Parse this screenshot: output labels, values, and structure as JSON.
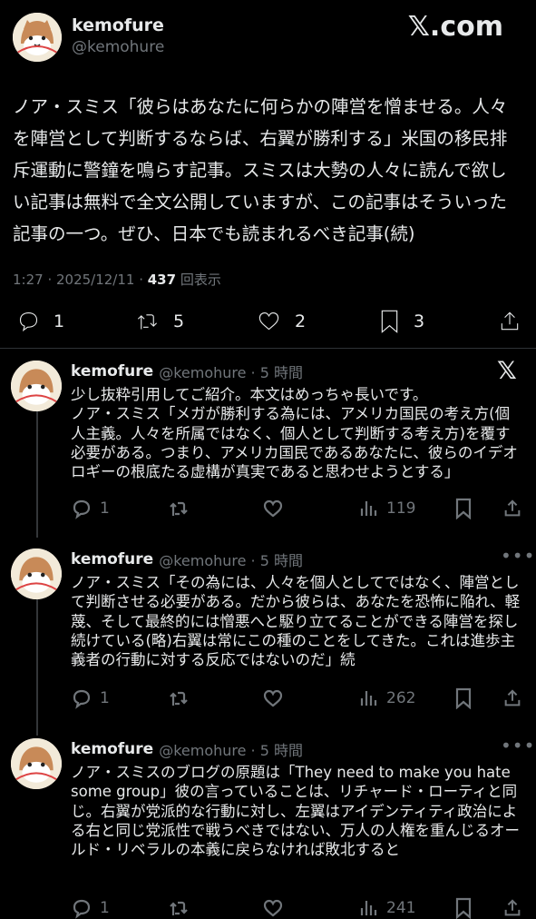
{
  "header": {
    "display_name": "kemofure",
    "handle": "@kemohure",
    "brand": "𝕏.com"
  },
  "main_post": {
    "text": "ノア・スミス「彼らはあなたに何らかの陣営を憎ませる。人々を陣営として判断するならば、右翼が勝利する」米国の移民排斥運動に警鐘を鳴らす記事。スミスは大勢の人々に読んで欲しい記事は無料で全文公開していますが、この記事はそういった記事の一つ。ぜひ、日本でも読まれるべき記事(続)",
    "time": "1:27 · 2025/12/11 · ",
    "views": "437",
    "views_label": " 回表示",
    "actions": {
      "reply": "1",
      "repost": "5",
      "like": "2",
      "bookmark": "3"
    }
  },
  "replies": [
    {
      "name": "kemofure",
      "handle_time": "@kemohure · 5 時間",
      "text": "少し抜粋引用してご紹介。本文はめっちゃ長いです。\nノア・スミス「メガが勝利する為には、アメリカ国民の考え方(個人主義。人々を所属ではなく、個人として判断する考え方)を覆す必要がある。つまり、アメリカ国民であるあなたに、彼らのイデオロギーの根底たる虚構が真実であると思わせようとする」",
      "reply": "1",
      "repost": "",
      "like": "",
      "views": "119"
    },
    {
      "name": "kemofure",
      "handle_time": "@kemohure · 5 時間",
      "text": "ノア・スミス「その為には、人々を個人としてではなく、陣営として判断させる必要がある。だから彼らは、あなたを恐怖に陥れ、軽蔑、そして最終的には憎悪へと駆り立てることができる陣営を探し続けている(略)右翼は常にこの種のことをしてきた。これは進歩主義者の行動に対する反応ではないのだ」続",
      "reply": "1",
      "repost": "",
      "like": "",
      "views": "262"
    },
    {
      "name": "kemofure",
      "handle_time": "@kemohure · 5 時間",
      "text": "ノア・スミスのブログの原題は「They need to make you hate some group」彼の言っていることは、リチャード・ローティと同じ。右翼が党派的な行動に対し、左翼はアイデンティティ政治による右と同じ党派性で戦うべきではない、万人の人権を重んじるオールド・リベラルの本義に戻らなければ敗北すると",
      "reply": "1",
      "repost": "",
      "like": "",
      "views": "241"
    }
  ]
}
